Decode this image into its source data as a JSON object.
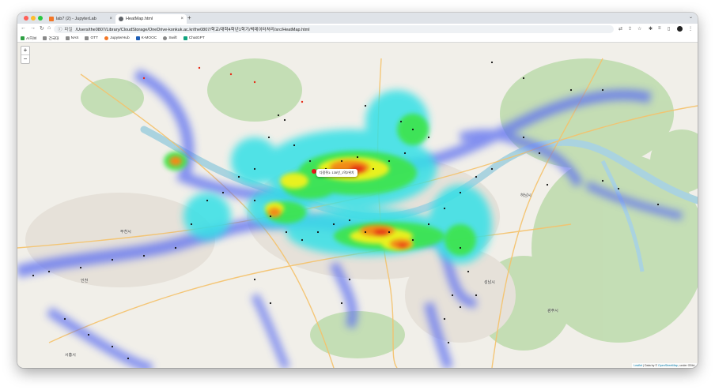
{
  "browser": {
    "tabs": [
      {
        "label": "lab7 (2) - JupyterLab",
        "active": false,
        "favicon_color": "#f37726"
      },
      {
        "label": "HeatMap.html",
        "active": true,
        "favicon_color": "#5f6368"
      }
    ],
    "address": {
      "scheme": "파일",
      "url": "/Users/the0807/Library/CloudStorage/OneDrive-konkuk.ac.kr/the0807/학교/대학4학년1학기/빅데이터처리/src/HeatMap.html"
    },
    "bookmarks": [
      {
        "label": "AI허브",
        "color": "#2ea043"
      },
      {
        "label": "건국대",
        "color": "#8a8a8a"
      },
      {
        "label": "NAS",
        "color": "#8a8a8a"
      },
      {
        "label": "OTT",
        "color": "#8a8a8a"
      },
      {
        "label": "JupyterHub",
        "color": "#f37726"
      },
      {
        "label": "K-MOOC",
        "color": "#1f5fb7"
      },
      {
        "label": "Swift",
        "color": "#888888"
      },
      {
        "label": "ChatGPT",
        "color": "#10a37f"
      }
    ]
  },
  "map": {
    "zoom_in": "+",
    "zoom_out": "−",
    "popup": "다람쥐1: 135년_1역2위치",
    "attribution": {
      "leaflet": "Leaflet",
      "middle": " | Data by © ",
      "osm": "OpenStreetMap",
      "tail": ", under ODbL."
    },
    "places": [
      {
        "label": "부천시"
      },
      {
        "label": "인천"
      },
      {
        "label": "하남시"
      },
      {
        "label": "광주시"
      },
      {
        "label": "성남시"
      },
      {
        "label": "시흥시"
      }
    ],
    "heat_colors": [
      "#3f6cf0",
      "#35e0e6",
      "#3ee44a",
      "#f2f21e",
      "#f28a16",
      "#e62a16"
    ]
  }
}
